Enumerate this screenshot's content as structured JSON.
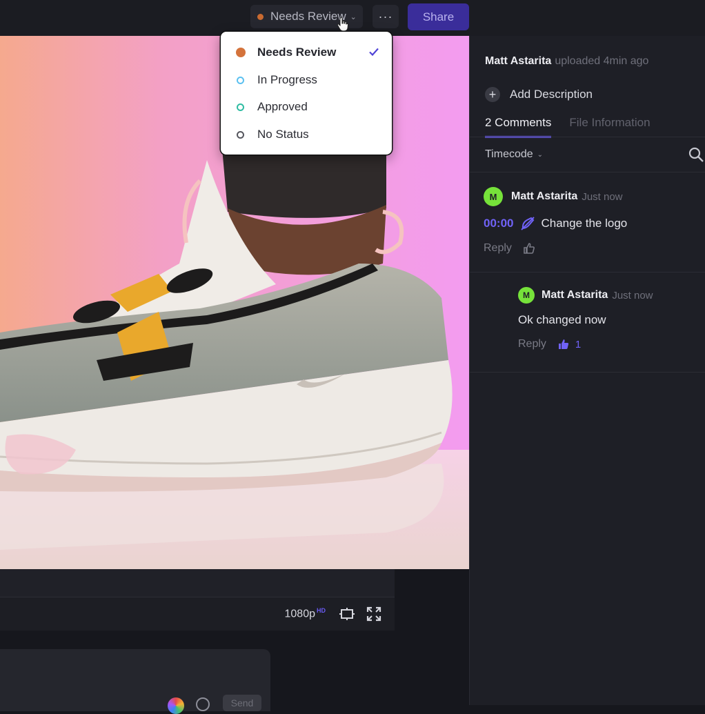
{
  "toolbar": {
    "status_label": "Needs Review",
    "status_color": "#c96a30",
    "more_label": "···",
    "share_label": "Share"
  },
  "status_menu": {
    "items": [
      {
        "label": "Needs Review",
        "color": "#d4733b",
        "selected": true
      },
      {
        "label": "In Progress",
        "color": "#5bc0f0",
        "selected": false
      },
      {
        "label": "Approved",
        "color": "#2fbca2",
        "selected": false
      },
      {
        "label": "No Status",
        "color": "#55565e",
        "selected": false
      }
    ]
  },
  "player": {
    "quality": "1080p",
    "quality_badge": "HD"
  },
  "composer": {
    "send_label": "Send"
  },
  "sidebar": {
    "uploader_name": "Matt Astarita",
    "uploader_meta": "uploaded 4min ago",
    "add_description": "Add Description",
    "tabs": [
      {
        "label": "2 Comments",
        "active": true
      },
      {
        "label": "File Information",
        "active": false
      }
    ],
    "filter_label": "Timecode"
  },
  "comments": [
    {
      "initial": "M",
      "author": "Matt Astarita",
      "time": "Just now",
      "timecode": "00:00",
      "text": "Change the logo",
      "reply_label": "Reply",
      "likes": ""
    },
    {
      "initial": "M",
      "author": "Matt Astarita",
      "time": "Just now",
      "text": "Ok changed now",
      "reply_label": "Reply",
      "likes": "1"
    }
  ],
  "colors": {
    "accent": "#6b5cf5",
    "avatar": "#76e23a"
  }
}
